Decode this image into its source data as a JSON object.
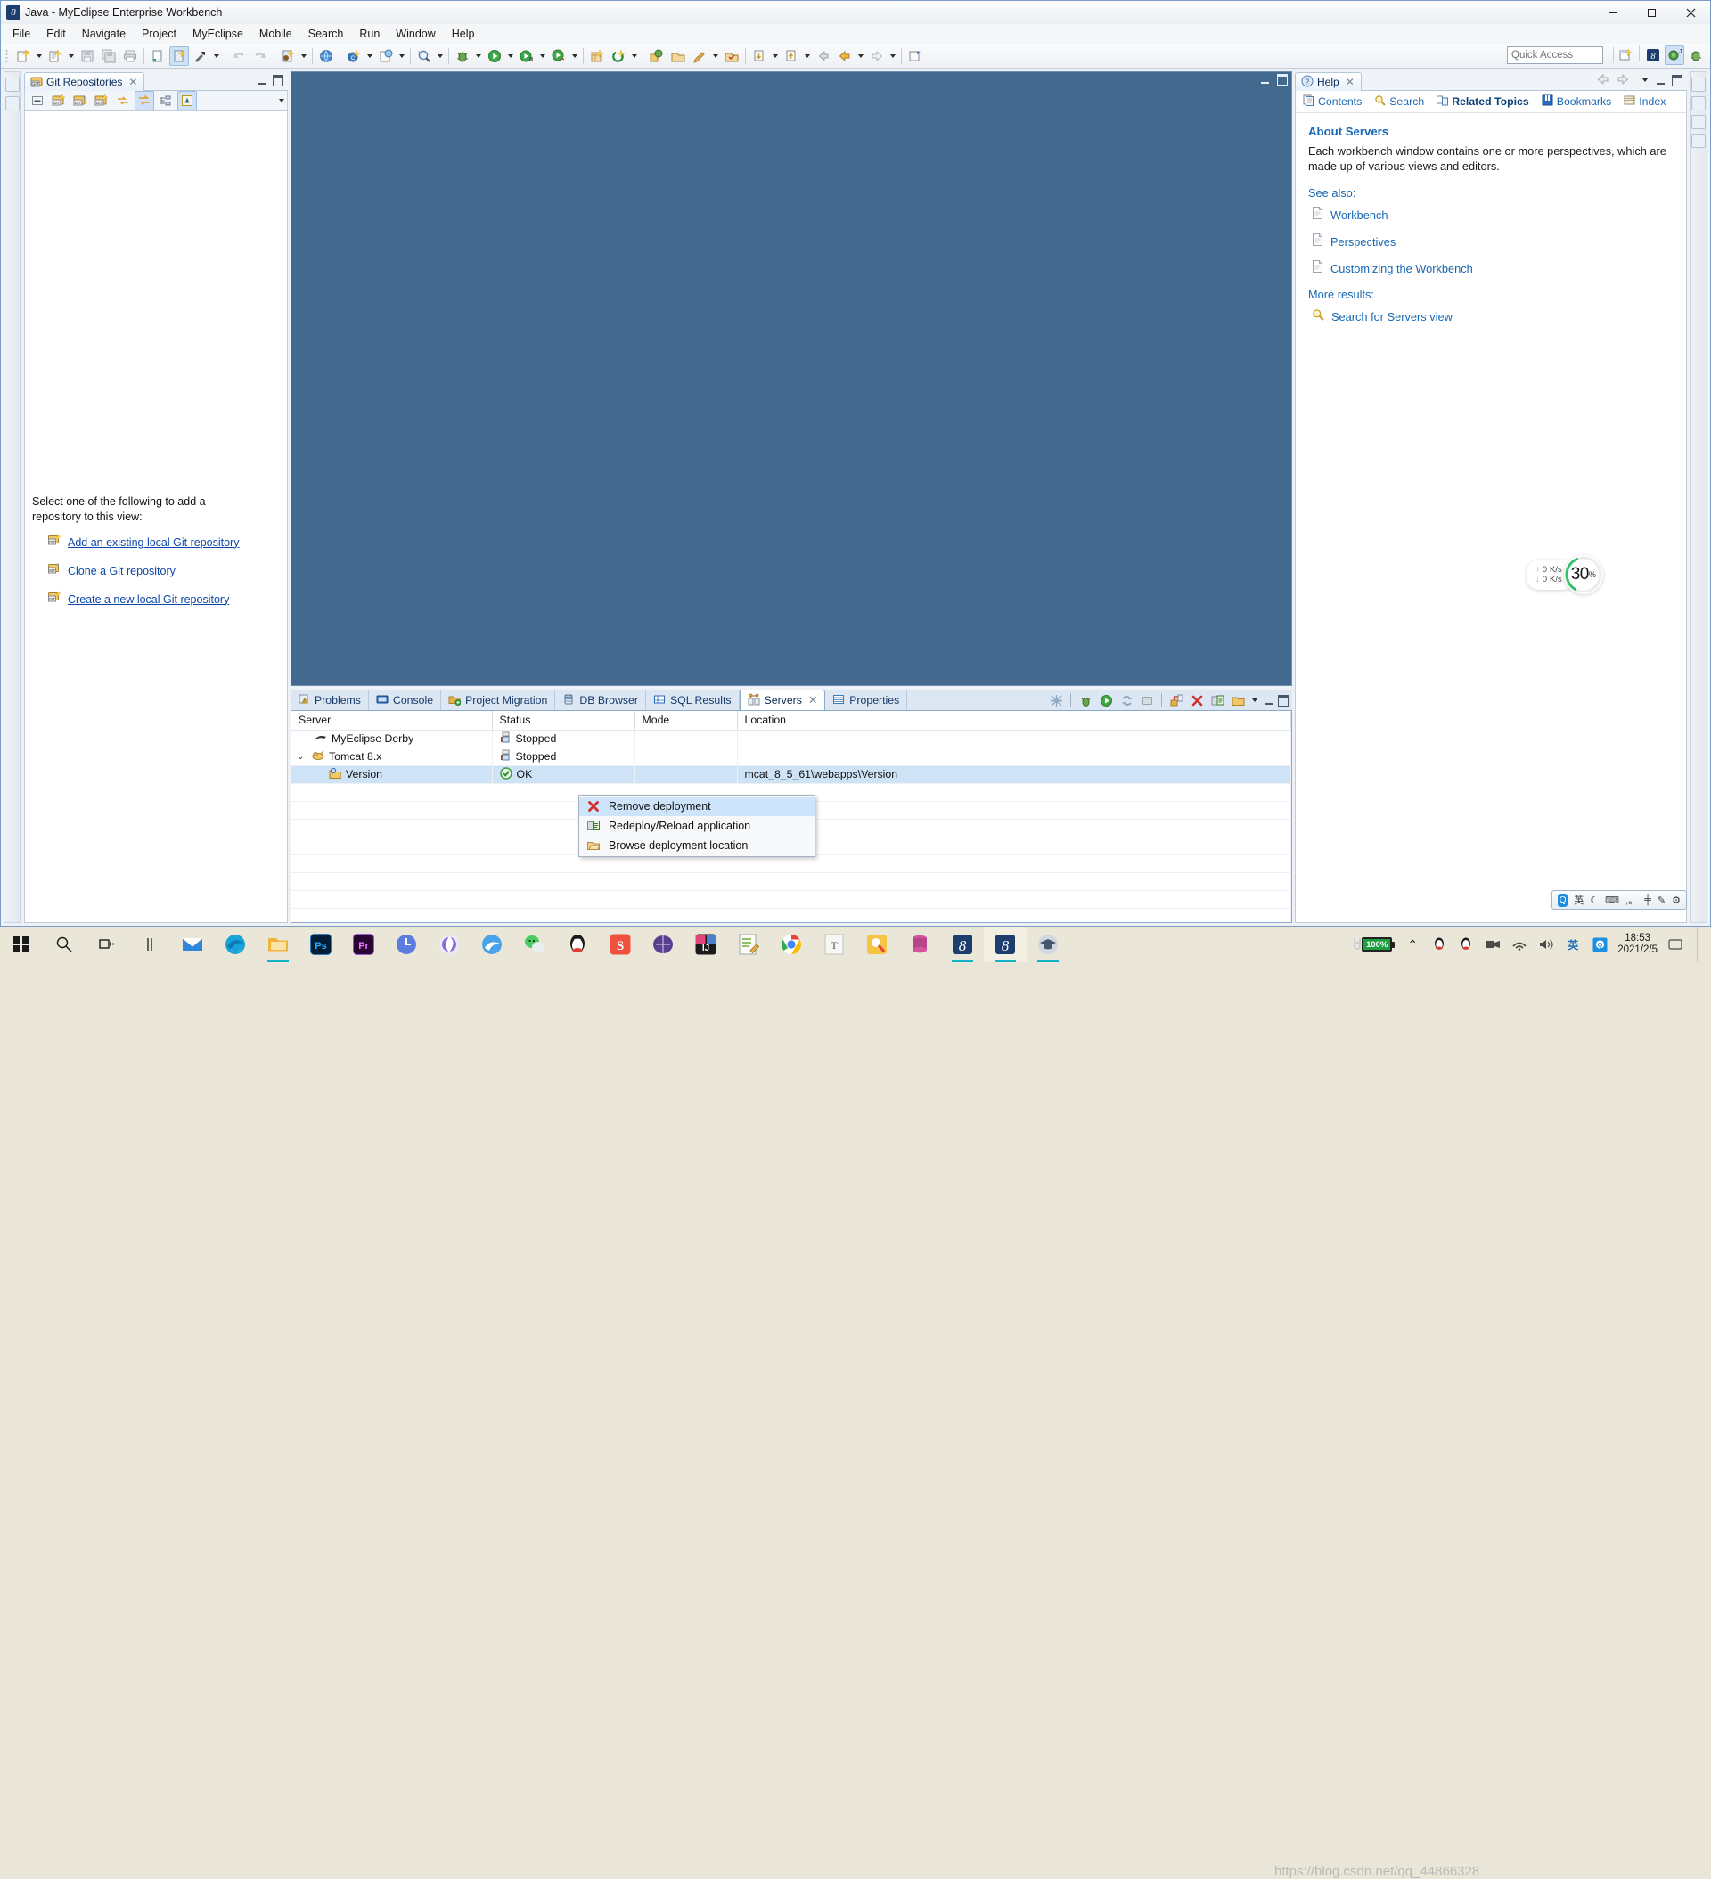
{
  "window": {
    "title": "Java - MyEclipse Enterprise Workbench",
    "app_icon": "myeclipse-icon",
    "minimize": "–",
    "maximize": "❐",
    "close": "✕"
  },
  "menubar": {
    "items": [
      {
        "label": "File"
      },
      {
        "label": "Edit"
      },
      {
        "label": "Navigate"
      },
      {
        "label": "Project"
      },
      {
        "label": "MyEclipse"
      },
      {
        "label": "Mobile"
      },
      {
        "label": "Search"
      },
      {
        "label": "Run"
      },
      {
        "label": "Window"
      },
      {
        "label": "Help"
      }
    ]
  },
  "toolbar": {
    "quick_access_placeholder": "Quick Access",
    "quick_access_value": "",
    "icons": [
      "new-wizard-icon",
      "new-from-template-icon",
      "save-icon",
      "save-all-icon",
      "print-icon",
      "new-project-icon",
      "new-web-project-icon",
      "build-icon",
      "undo-icon",
      "redo-icon",
      "deploy-icon",
      "open-browser-icon",
      "new-class-icon",
      "search-icon",
      "open-type-icon",
      "open-resource-icon",
      "debug-icon",
      "run-icon",
      "run-configurations-icon",
      "external-tools-icon",
      "new-package-icon",
      "refresh-icon",
      "git-commit-icon",
      "git-push-icon",
      "annotate-icon",
      "validate-icon",
      "next-annotation-icon",
      "previous-annotation-icon",
      "back-icon",
      "forward-icon",
      "pin-editor-icon"
    ],
    "perspective_icons": [
      "open-perspective-icon",
      "java-perspective-icon",
      "myeclipse-java-ee-perspective-icon",
      "debug-perspective-icon"
    ]
  },
  "git_view": {
    "tab_label": "Git Repositories",
    "tab_icon": "git-repo-icon",
    "close_icon": "✕",
    "toolbar_icons": [
      "collapse-all-icon",
      "add-repo-icon",
      "clone-repo-icon",
      "create-repo-icon",
      "fetch-icon",
      "push-icon",
      "link-with-selection-icon",
      "view-menu-icon"
    ],
    "empty_message_line1": "Select one of the following to add a",
    "empty_message_line2": "repository to this view:",
    "links": [
      {
        "label": "Add an existing local Git repository",
        "icon": "add-git-repo-icon"
      },
      {
        "label": "Clone a Git repository",
        "icon": "clone-git-repo-icon"
      },
      {
        "label": "Create a new local Git repository",
        "icon": "create-git-repo-icon"
      }
    ]
  },
  "editor_area": {
    "empty": true,
    "background_color": "#44698f"
  },
  "bottom_panel": {
    "tabs": [
      {
        "label": "Problems",
        "icon": "problems-icon",
        "active": false
      },
      {
        "label": "Console",
        "icon": "console-icon",
        "active": false
      },
      {
        "label": "Project Migration",
        "icon": "project-migration-icon",
        "active": false
      },
      {
        "label": "DB Browser",
        "icon": "db-browser-icon",
        "active": false
      },
      {
        "label": "SQL Results",
        "icon": "sql-results-icon",
        "active": false
      },
      {
        "label": "Servers",
        "icon": "servers-icon",
        "active": true,
        "closable": true
      },
      {
        "label": "Properties",
        "icon": "properties-icon",
        "active": false
      }
    ],
    "toolbar_icons": [
      "servers-filter-icon",
      "debug-server-icon",
      "start-server-icon",
      "restart-server-icon",
      "stop-server-icon",
      "publish-icon",
      "remove-deployment-icon",
      "redeploy-icon",
      "browse-location-icon",
      "view-menu-icon",
      "minimize-icon",
      "maximize-icon"
    ],
    "servers_table": {
      "columns": [
        "Server",
        "Status",
        "Mode",
        "Location"
      ],
      "rows": [
        {
          "server": "MyEclipse Derby",
          "icon": "derby-icon",
          "status": "Stopped",
          "status_icon": "stopped-icon",
          "mode": "",
          "location": "",
          "indent": 1,
          "expandable": false,
          "selected": false
        },
        {
          "server": "Tomcat  8.x",
          "icon": "tomcat-icon",
          "status": "Stopped",
          "status_icon": "stopped-icon",
          "mode": "",
          "location": "",
          "indent": 0,
          "expandable": true,
          "expanded": true,
          "selected": false
        },
        {
          "server": "Version",
          "icon": "webapp-icon",
          "status": "OK",
          "status_icon": "ok-icon",
          "mode": "",
          "location": "mcat_8_5_61\\webapps\\Version",
          "indent": 2,
          "expandable": false,
          "selected": true
        }
      ]
    }
  },
  "context_menu": {
    "items": [
      {
        "label": "Remove deployment",
        "icon": "remove-deployment-icon",
        "highlighted": true
      },
      {
        "label": "Redeploy/Reload application",
        "icon": "redeploy-icon",
        "highlighted": false
      },
      {
        "label": "Browse deployment location",
        "icon": "folder-open-icon",
        "highlighted": false
      }
    ]
  },
  "help_view": {
    "tab_label": "Help",
    "tab_icon": "help-icon",
    "close_icon": "✕",
    "nav": [
      {
        "label": "Contents",
        "icon": "contents-icon",
        "current": false
      },
      {
        "label": "Search",
        "icon": "search-help-icon",
        "current": false
      },
      {
        "label": "Related Topics",
        "icon": "related-topics-icon",
        "current": true
      },
      {
        "label": "Bookmarks",
        "icon": "bookmarks-icon",
        "current": false
      },
      {
        "label": "Index",
        "icon": "index-icon",
        "current": false
      }
    ],
    "back_icon": "back-arrow-icon",
    "forward_icon": "forward-arrow-icon",
    "heading": "About Servers",
    "body": "Each workbench window contains one or more perspectives, which are made up of various views and editors.",
    "see_also_label": "See also:",
    "see_also": [
      {
        "label": "Workbench",
        "icon": "doc-icon"
      },
      {
        "label": "Perspectives",
        "icon": "doc-icon"
      },
      {
        "label": "Customizing the Workbench",
        "icon": "doc-icon"
      }
    ],
    "more_results_label": "More results:",
    "more_results": [
      {
        "label": "Search for Servers view",
        "icon": "search-help-icon"
      }
    ]
  },
  "net_widget": {
    "upload": "0",
    "upload_unit": "K/s",
    "download": "0",
    "download_unit": "K/s",
    "percent": "30",
    "percent_symbol": "%",
    "accent_color": "#35c46a"
  },
  "ime_bar": {
    "logo": "Q",
    "mode": "英",
    "icons": [
      "moon-icon",
      "keyboard-icon",
      "punctuation-icon",
      "halfwidth-icon",
      "toolbox-icon",
      "settings-icon"
    ]
  },
  "taskbar": {
    "start_icon": "windows-start-icon",
    "search_icon": "search-icon",
    "taskview_icon": "task-view-icon",
    "widgets_icon": "widgets-icon",
    "apps": [
      {
        "name": "mail-icon",
        "glyph": "✉",
        "color": "#2d8fe0",
        "running": false
      },
      {
        "name": "edge-icon",
        "glyph": "",
        "color": "#27a3d8",
        "running": false
      },
      {
        "name": "file-explorer-icon",
        "glyph": "",
        "color": "#e9b44c",
        "running": true
      },
      {
        "name": "photoshop-icon",
        "glyph": "Ps",
        "color": "#001e36",
        "running": false
      },
      {
        "name": "premiere-icon",
        "glyph": "Pr",
        "color": "#2a0634",
        "running": false
      },
      {
        "name": "clock-icon",
        "glyph": "",
        "color": "#5b7ce0",
        "running": false
      },
      {
        "name": "recovery-icon",
        "glyph": "",
        "color": "#8a6bd8",
        "running": false
      },
      {
        "name": "cloud-music-icon",
        "glyph": "",
        "color": "#4aa3e8",
        "running": false
      },
      {
        "name": "wechat-icon",
        "glyph": "",
        "color": "#4bcb5f",
        "running": false
      },
      {
        "name": "qq-icon",
        "glyph": "",
        "color": "#1a1a1a",
        "running": false
      },
      {
        "name": "sogou-icon",
        "glyph": "S",
        "color": "#f0513f",
        "running": false
      },
      {
        "name": "navicat-icon",
        "glyph": "",
        "color": "#5b3f8f",
        "running": false
      },
      {
        "name": "intellij-idea-icon",
        "glyph": "IJ",
        "color": "#e0457b",
        "running": false
      },
      {
        "name": "notepad-icon",
        "glyph": "",
        "color": "#7fbf4d",
        "running": false
      },
      {
        "name": "chrome-icon",
        "glyph": "",
        "color": "#e94335",
        "running": false
      },
      {
        "name": "typora-icon",
        "glyph": "T",
        "color": "#f5f5f5",
        "running": false
      },
      {
        "name": "pdf-reader-icon",
        "glyph": "",
        "color": "#f6c445",
        "running": false
      },
      {
        "name": "database-icon",
        "glyph": "",
        "color": "#d4559e",
        "running": false
      },
      {
        "name": "myeclipse-icon-1",
        "glyph": "",
        "color": "#1d3d6e",
        "running": true
      },
      {
        "name": "myeclipse-icon-2",
        "glyph": "",
        "color": "#1d3d6e",
        "running": true,
        "active": true
      },
      {
        "name": "education-icon",
        "glyph": "",
        "color": "#9bb0c4",
        "running": true
      }
    ],
    "tray": {
      "chevron": "⌃",
      "battery_percent": "100%",
      "icons": [
        "qq-tray-icon",
        "qq-tray-icon-2",
        "screen-recorder-icon",
        "network-icon",
        "volume-icon",
        "ime-icon",
        "qq-browser-icon"
      ],
      "ime_label": "英",
      "time": "18:53",
      "date": "2021/2/5"
    },
    "watermark": "https://blog.csdn.net/qq_44866328"
  }
}
